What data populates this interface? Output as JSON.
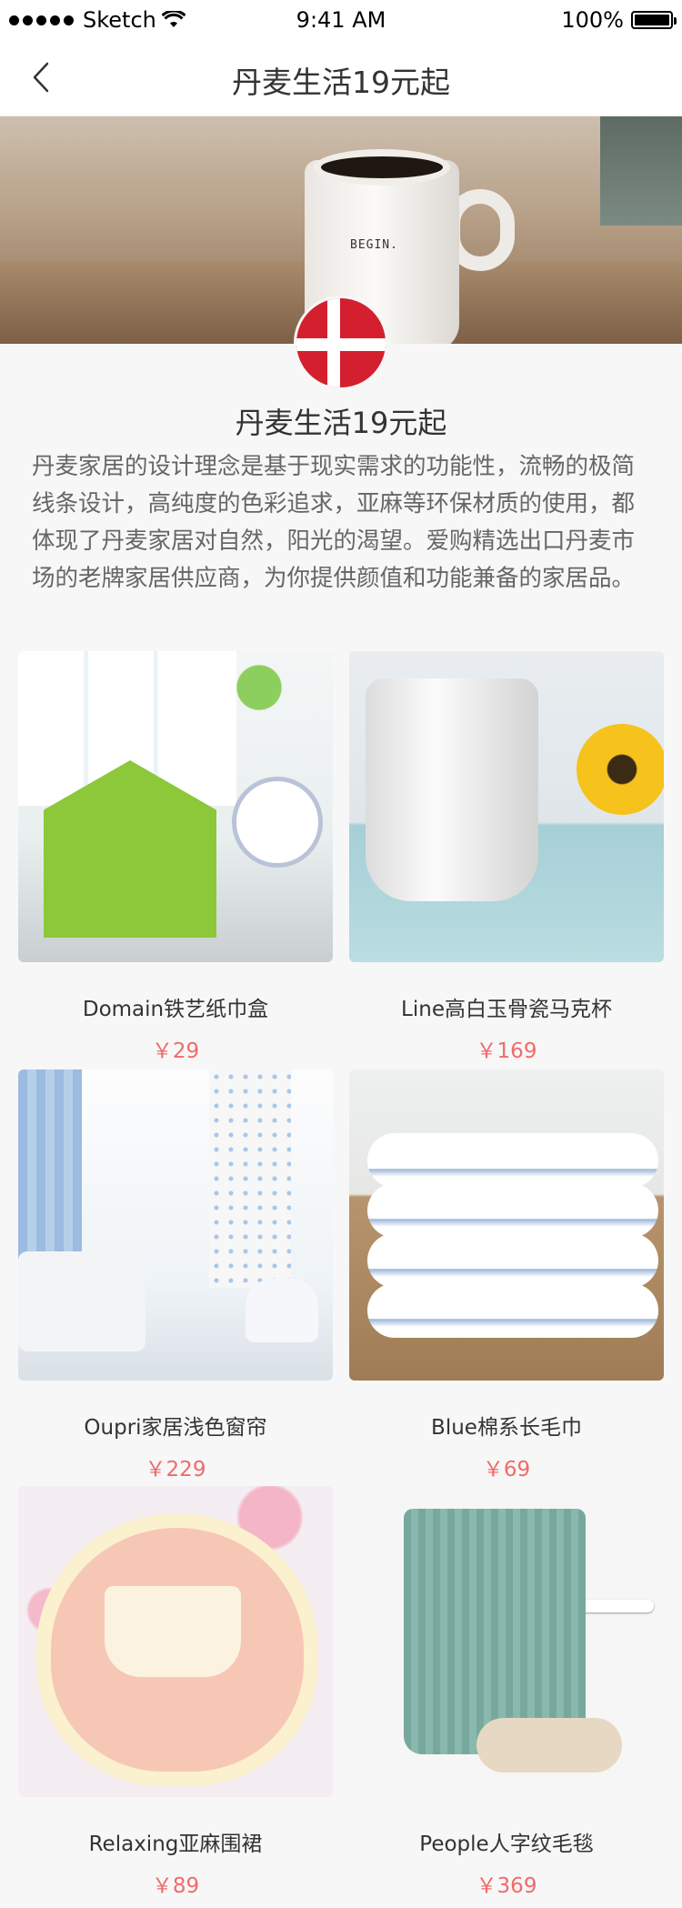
{
  "status_bar": {
    "carrier": "Sketch",
    "time": "9:41 AM",
    "battery": "100%",
    "battery_level": 1.0
  },
  "nav": {
    "title": "丹麦生活19元起",
    "back_icon": "chevron-left-icon"
  },
  "hero": {
    "mug_text": "BEGIN."
  },
  "section": {
    "title": "丹麦生活19元起",
    "intro": "丹麦家居的设计理念是基于现实需求的功能性，流畅的极简线条设计，高纯度的色彩追求，亚麻等环保材质的使用，都体现了丹麦家居对自然，阳光的渴望。爱购精选出口丹麦市场的老牌家居供应商，为你提供颜值和功能兼备的家居品。"
  },
  "products": [
    {
      "name": "Domain铁艺纸巾盒",
      "price": "￥29"
    },
    {
      "name": "Line高白玉骨瓷马克杯",
      "price": "￥169"
    },
    {
      "name": "Oupri家居浅色窗帘",
      "price": "￥229"
    },
    {
      "name": "Blue棉系长毛巾",
      "price": "￥69"
    },
    {
      "name": "Relaxing亚麻围裙",
      "price": "￥89"
    },
    {
      "name": "People人字纹毛毯",
      "price": "￥369"
    }
  ],
  "colors": {
    "price": "#f06b6b",
    "flag_red": "#d4202e",
    "background": "#f7f7f7"
  }
}
